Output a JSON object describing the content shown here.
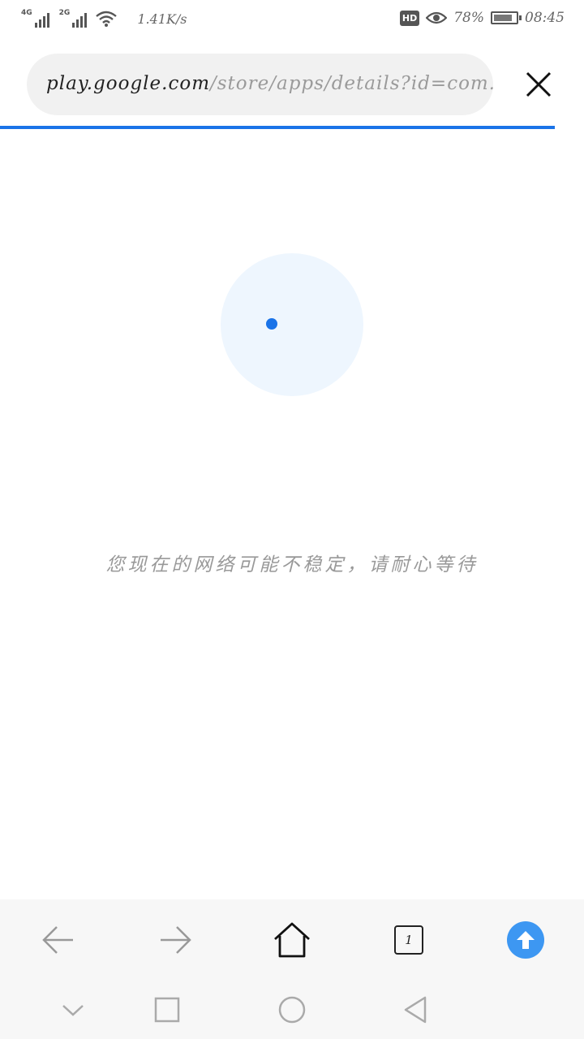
{
  "status_bar": {
    "net1": "4G",
    "net2": "2G",
    "speed": "1.41K/s",
    "hd": "HD",
    "battery": "78%",
    "time": "08:45",
    "icons": [
      "signal-icon",
      "wifi-icon",
      "eye-icon",
      "battery-icon"
    ]
  },
  "address_bar": {
    "host": "play.google.com",
    "path": "/store/apps/details?id=com.seg"
  },
  "page": {
    "message": "您现在的网络可能不稳定，请耐心等待"
  },
  "toolbar": {
    "tab_count": "1",
    "icons": [
      "back-arrow-icon",
      "forward-arrow-icon",
      "home-icon",
      "tabs-icon",
      "upload-icon"
    ]
  },
  "nav_bar": {
    "icons": [
      "chevron-down-icon",
      "recent-apps-icon",
      "home-circle-icon",
      "back-triangle-icon"
    ]
  },
  "colors": {
    "accent": "#1a73e8",
    "upload": "#3d97f2",
    "loader_bg": "#eef6fe"
  }
}
